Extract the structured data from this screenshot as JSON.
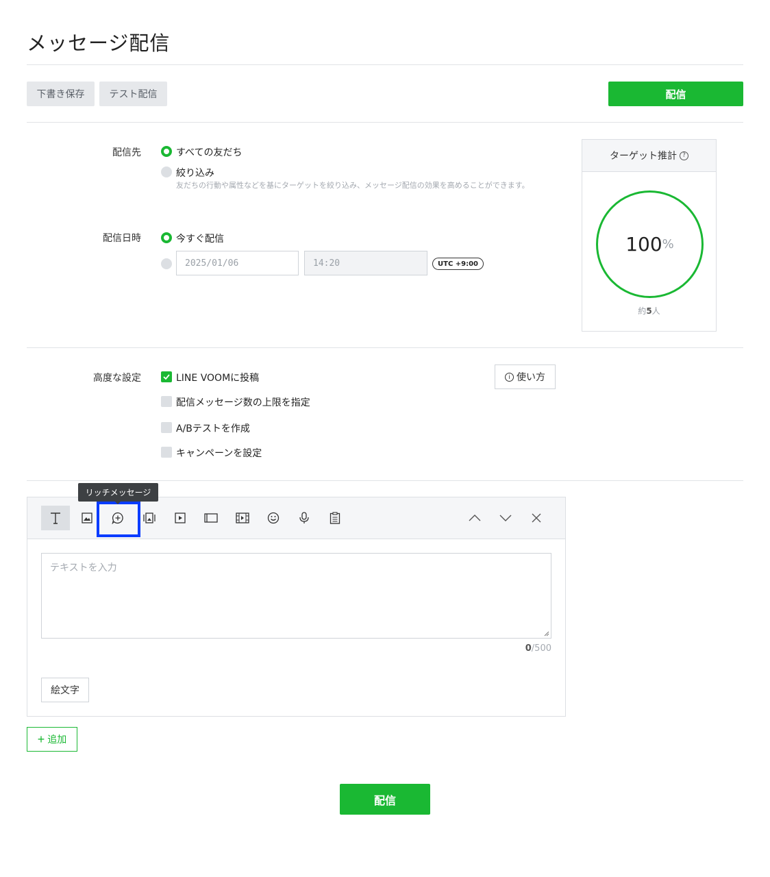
{
  "page": {
    "title": "メッセージ配信"
  },
  "toolbar": {
    "draft_label": "下書き保存",
    "test_label": "テスト配信",
    "send_label": "配信"
  },
  "recipient": {
    "label": "配信先",
    "all_friends": "すべての友だち",
    "narrow": "絞り込み",
    "narrow_hint": "友だちの行動や属性などを基にターゲットを絞り込み、メッセージ配信の効果を高めることができます。"
  },
  "schedule": {
    "label": "配信日時",
    "now": "今すぐ配信",
    "date_value": "2025/01/06",
    "time_value": "14:20",
    "timezone": "UTC +9:00"
  },
  "target": {
    "title": "ターゲット推計",
    "help_icon": "?",
    "percent_value": "100",
    "percent_unit": "%",
    "reach_prefix": "約",
    "reach_count": "5",
    "reach_unit": "人"
  },
  "advanced": {
    "label": "高度な設定",
    "options": [
      {
        "label": "LINE VOOMに投稿",
        "checked": true
      },
      {
        "label": "配信メッセージ数の上限を指定",
        "checked": false
      },
      {
        "label": "A/Bテストを作成",
        "checked": false
      },
      {
        "label": "キャンペーンを設定",
        "checked": false
      }
    ],
    "howto_label": "使い方",
    "info_icon": "i"
  },
  "editor": {
    "tooltip": "リッチメッセージ",
    "tools": [
      "text-icon",
      "image-icon",
      "rich-message-icon",
      "card-message-icon",
      "video-icon",
      "rich-video-icon",
      "movie-icon",
      "emoji-icon",
      "voice-icon",
      "coupon-icon"
    ],
    "placeholder": "テキストを入力",
    "count": "0",
    "max": "/500",
    "emoji_label": "絵文字"
  },
  "footer": {
    "add_label": "追加",
    "send_label": "配信"
  },
  "colors": {
    "accent": "#1ab833",
    "highlight": "#0a3cff"
  }
}
